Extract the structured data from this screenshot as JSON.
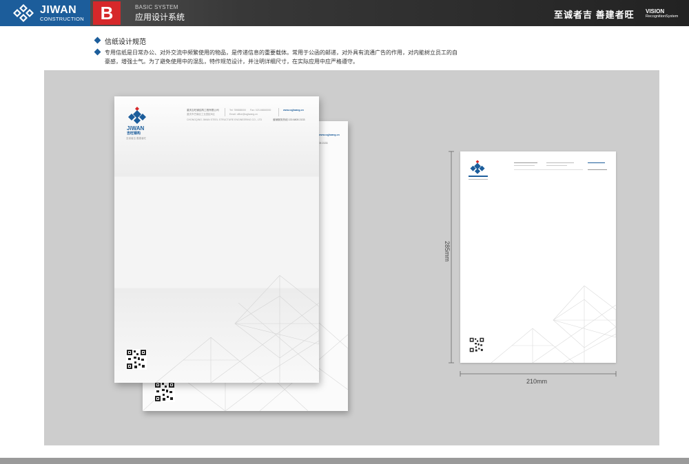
{
  "header": {
    "brand_name": "JIWAN",
    "brand_sub": "CONSTRUCTION",
    "section_letter": "B",
    "section_en": "BASIC SYSTEM",
    "section_cn": "应用设计系统",
    "slogan": "至诚者吉  善建者旺",
    "vision_line1": "VISION",
    "vision_line2": "RecognitionSystem"
  },
  "colors": {
    "brand_blue": "#1c5d9b",
    "brand_red": "#d6282a",
    "header_dark": "#2a2a2a",
    "showcase_bg": "#cdcdcd"
  },
  "content": {
    "title": "信纸设计规范",
    "description_line1": "专用信纸是日常办公、对外交流中频繁使用的物品，是传递信息的重要载体。常用于公函的邮递，对外具有流通广告的作用，对内能树立员工的自",
    "description_line2": "豪感，增强士气。为了避免使用中的混乱，特作规范设计，并注明详细尺寸，在实际应用中应严格遵守。"
  },
  "letterhead": {
    "logo_text": "JiWAN",
    "logo_cn": "吉旺钢构",
    "tagline": "至诚者吉  善建者旺",
    "company_cn": "重庆吉旺钢结构工程有限公司",
    "address": "重庆市巴南区工业园区B区",
    "company_en": "CHONGQING JIWAN STEEL STRUCTURE ENGINEERING CO., LTD",
    "tel": "Tel: 789888000",
    "fax": "Fax: 023-66660000",
    "email": "Email: office@cqjiwang.cn",
    "web": "www.cqjiwang.cn",
    "hotline": "营销服务热线 133 6805 2133"
  },
  "dimensions": {
    "width_label": "210mm",
    "height_label": "285mm"
  },
  "icons": [
    "jiwan-logo-icon",
    "qr-code-icon",
    "diamond-bullet-icon"
  ]
}
